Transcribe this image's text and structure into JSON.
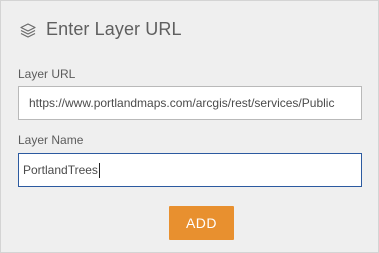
{
  "header": {
    "icon": "layers-icon",
    "title": "Enter Layer URL"
  },
  "fields": {
    "url": {
      "label": "Layer URL",
      "value": "https://www.portlandmaps.com/arcgis/rest/services/Public"
    },
    "name": {
      "label": "Layer Name",
      "value": "PortlandTrees"
    }
  },
  "actions": {
    "add_label": "ADD"
  },
  "colors": {
    "accent": "#e8902f",
    "focus_border": "#2c5aa0",
    "panel_bg": "#efefef"
  }
}
